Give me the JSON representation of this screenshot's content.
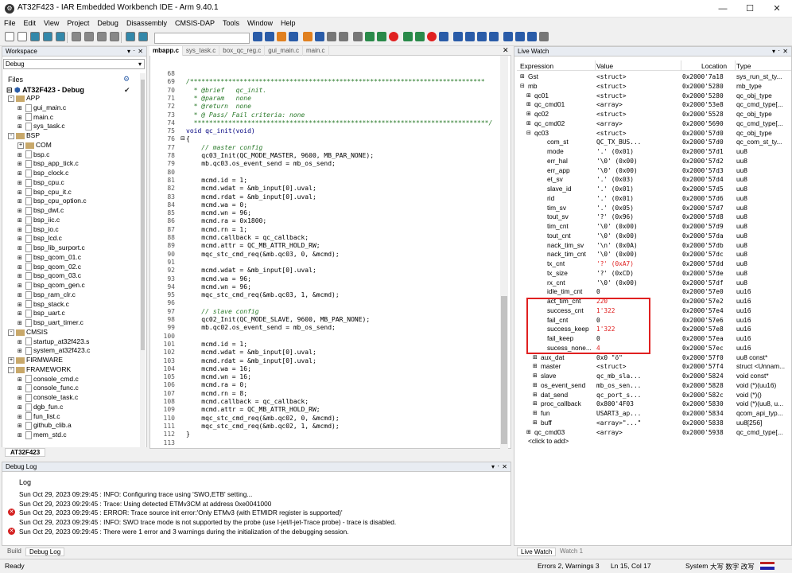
{
  "window": {
    "title": "AT32F423 - IAR Embedded Workbench IDE - Arm 9.40.1"
  },
  "menu": [
    "File",
    "Edit",
    "View",
    "Project",
    "Debug",
    "Disassembly",
    "CMSIS-DAP",
    "Tools",
    "Window",
    "Help"
  ],
  "workspace": {
    "title": "Workspace",
    "config": "Debug",
    "files_label": "Files",
    "project": "AT32F423 - Debug",
    "tab": "AT32F423",
    "tree": [
      {
        "d": 1,
        "k": "folder",
        "t": "APP",
        "ex": "-"
      },
      {
        "d": 2,
        "k": "file",
        "t": "gui_main.c"
      },
      {
        "d": 2,
        "k": "file",
        "t": "main.c"
      },
      {
        "d": 2,
        "k": "file",
        "t": "sys_task.c"
      },
      {
        "d": 1,
        "k": "folder",
        "t": "BSP",
        "ex": "-"
      },
      {
        "d": 2,
        "k": "folder",
        "t": "COM",
        "ex": "+"
      },
      {
        "d": 2,
        "k": "file",
        "t": "bsp.c"
      },
      {
        "d": 2,
        "k": "file",
        "t": "bsp_app_tick.c"
      },
      {
        "d": 2,
        "k": "file",
        "t": "bsp_clock.c"
      },
      {
        "d": 2,
        "k": "file",
        "t": "bsp_cpu.c"
      },
      {
        "d": 2,
        "k": "file",
        "t": "bsp_cpu_it.c"
      },
      {
        "d": 2,
        "k": "file",
        "t": "bsp_cpu_option.c"
      },
      {
        "d": 2,
        "k": "file",
        "t": "bsp_dwt.c"
      },
      {
        "d": 2,
        "k": "file",
        "t": "bsp_iic.c"
      },
      {
        "d": 2,
        "k": "file",
        "t": "bsp_io.c"
      },
      {
        "d": 2,
        "k": "file",
        "t": "bsp_lcd.c"
      },
      {
        "d": 2,
        "k": "file",
        "t": "bsp_lib_surport.c"
      },
      {
        "d": 2,
        "k": "file",
        "t": "bsp_qcom_01.c"
      },
      {
        "d": 2,
        "k": "file",
        "t": "bsp_qcom_02.c"
      },
      {
        "d": 2,
        "k": "file",
        "t": "bsp_qcom_03.c"
      },
      {
        "d": 2,
        "k": "file",
        "t": "bsp_qcom_gen.c"
      },
      {
        "d": 2,
        "k": "file",
        "t": "bsp_ram_clr.c"
      },
      {
        "d": 2,
        "k": "file",
        "t": "bsp_stack.c"
      },
      {
        "d": 2,
        "k": "file",
        "t": "bsp_uart.c"
      },
      {
        "d": 2,
        "k": "file",
        "t": "bsp_uart_timer.c"
      },
      {
        "d": 1,
        "k": "folder",
        "t": "CMSIS",
        "ex": "-"
      },
      {
        "d": 2,
        "k": "file",
        "t": "startup_at32f423.s"
      },
      {
        "d": 2,
        "k": "file",
        "t": "system_at32f423.c"
      },
      {
        "d": 1,
        "k": "folder",
        "t": "FIRMWARE",
        "ex": "+"
      },
      {
        "d": 1,
        "k": "folder",
        "t": "FRAMEWORK",
        "ex": "-"
      },
      {
        "d": 2,
        "k": "file",
        "t": "console_cmd.c"
      },
      {
        "d": 2,
        "k": "file",
        "t": "console_func.c"
      },
      {
        "d": 2,
        "k": "file",
        "t": "console_task.c"
      },
      {
        "d": 2,
        "k": "file",
        "t": "dgb_fun.c"
      },
      {
        "d": 2,
        "k": "file",
        "t": "fun_list.c"
      },
      {
        "d": 2,
        "k": "file",
        "t": "github_clib.a"
      },
      {
        "d": 2,
        "k": "file",
        "t": "mem_std.c"
      }
    ]
  },
  "editor": {
    "tabs": [
      "mbapp.c",
      "sys_task.c",
      "box_qc_reg.c",
      "gui_main.c",
      "main.c"
    ],
    "lines": [
      [
        "68",
        ""
      ],
      [
        "69",
        "/*****************************************************************************",
        "c"
      ],
      [
        "70",
        "  * @brief   qc_init.",
        "c"
      ],
      [
        "71",
        "  * @param   none",
        "c"
      ],
      [
        "72",
        "  * @return  none",
        "c"
      ],
      [
        "73",
        "  * @ Pass/ Fail criteria: none",
        "c"
      ],
      [
        "74",
        "  *****************************************************************************/",
        "c"
      ],
      [
        "75",
        "void qc_init(void)",
        "k"
      ],
      [
        "76",
        "{"
      ],
      [
        "77",
        "    // master config",
        "c"
      ],
      [
        "78",
        "    qc03_Init(QC_MODE_MASTER, 9600, MB_PAR_NONE);"
      ],
      [
        "79",
        "    mb.qc03.os_event_send = mb_os_send;"
      ],
      [
        "80",
        ""
      ],
      [
        "81",
        "    mcmd.id = 1;"
      ],
      [
        "82",
        "    mcmd.wdat = &mb_input[0].uval;"
      ],
      [
        "83",
        "    mcmd.rdat = &mb_input[0].uval;"
      ],
      [
        "84",
        "    mcmd.wa = 0;"
      ],
      [
        "85",
        "    mcmd.wn = 96;"
      ],
      [
        "86",
        "    mcmd.ra = 0x1800;"
      ],
      [
        "87",
        "    mcmd.rn = 1;"
      ],
      [
        "88",
        "    mcmd.callback = qc_callback;"
      ],
      [
        "89",
        "    mcmd.attr = QC_MB_ATTR_HOLD_RW;"
      ],
      [
        "90",
        "    mqc_stc_cmd_req(&mb.qc03, 0, &mcmd);"
      ],
      [
        "91",
        ""
      ],
      [
        "92",
        "    mcmd.wdat = &mb_input[0].uval;"
      ],
      [
        "93",
        "    mcmd.wa = 96;"
      ],
      [
        "94",
        "    mcmd.wn = 96;"
      ],
      [
        "95",
        "    mqc_stc_cmd_req(&mb.qc03, 1, &mcmd);"
      ],
      [
        "96",
        ""
      ],
      [
        "97",
        "    // slave config",
        "c"
      ],
      [
        "98",
        "    qc02_Init(QC_MODE_SLAVE, 9600, MB_PAR_NONE);"
      ],
      [
        "99",
        "    mb.qc02.os_event_send = mb_os_send;"
      ],
      [
        "100",
        ""
      ],
      [
        "101",
        "    mcmd.id = 1;"
      ],
      [
        "102",
        "    mcmd.wdat = &mb_input[0].uval;"
      ],
      [
        "103",
        "    mcmd.rdat = &mb_input[0].uval;"
      ],
      [
        "104",
        "    mcmd.wa = 16;"
      ],
      [
        "105",
        "    mcmd.wn = 16;"
      ],
      [
        "106",
        "    mcmd.ra = 0;"
      ],
      [
        "107",
        "    mcmd.rn = 8;"
      ],
      [
        "108",
        "    mcmd.callback = qc_callback;"
      ],
      [
        "109",
        "    mcmd.attr = QC_MB_ATTR_HOLD_RW;"
      ],
      [
        "110",
        "    mqc_stc_cmd_req(&mb.qc02, 0, &mcmd);"
      ],
      [
        "111",
        "    mqc_stc_cmd_req(&mb.qc02, 1, &mcmd);"
      ],
      [
        "112",
        "}"
      ],
      [
        "113",
        ""
      ]
    ]
  },
  "livewatch": {
    "title": "Live Watch",
    "cols": [
      "Expression",
      "Value",
      "Location",
      "Type"
    ],
    "rows": [
      {
        "d": 0,
        "ex": "+",
        "e": "Gst",
        "v": "<struct>",
        "l": "0x2000'7a18",
        "t": "sys_run_st_ty..."
      },
      {
        "d": 0,
        "ex": "-",
        "e": "mb",
        "v": "<struct>",
        "l": "0x2000'5280",
        "t": "mb_type"
      },
      {
        "d": 1,
        "ex": "+",
        "e": "qc01",
        "v": "<struct>",
        "l": "0x2000'5280",
        "t": "qc_obj_type"
      },
      {
        "d": 1,
        "ex": "+",
        "e": "qc_cmd01",
        "v": "<array>",
        "l": "0x2000'53e8",
        "t": "qc_cmd_type[..."
      },
      {
        "d": 1,
        "ex": "+",
        "e": "qc02",
        "v": "<struct>",
        "l": "0x2000'5528",
        "t": "qc_obj_type"
      },
      {
        "d": 1,
        "ex": "+",
        "e": "qc_cmd02",
        "v": "<array>",
        "l": "0x2000'5690",
        "t": "qc_cmd_type[..."
      },
      {
        "d": 1,
        "ex": "-",
        "e": "qc03",
        "v": "<struct>",
        "l": "0x2000'57d0",
        "t": "qc_obj_type"
      },
      {
        "d": 2,
        "ex": "",
        "e": "com_st",
        "v": "QC_TX_BUS...",
        "l": "0x2000'57d0",
        "t": "qc_com_st_ty..."
      },
      {
        "d": 2,
        "ex": "",
        "e": "mode",
        "v": "'.' (0x01)",
        "l": "0x2000'57d1",
        "t": "uu8"
      },
      {
        "d": 2,
        "ex": "",
        "e": "err_hal",
        "v": "'\\0' (0x00)",
        "l": "0x2000'57d2",
        "t": "uu8"
      },
      {
        "d": 2,
        "ex": "",
        "e": "err_app",
        "v": "'\\0' (0x00)",
        "l": "0x2000'57d3",
        "t": "uu8"
      },
      {
        "d": 2,
        "ex": "",
        "e": "et_sv",
        "v": "'.' (0x03)",
        "l": "0x2000'57d4",
        "t": "uu8"
      },
      {
        "d": 2,
        "ex": "",
        "e": "slave_id",
        "v": "'.' (0x01)",
        "l": "0x2000'57d5",
        "t": "uu8"
      },
      {
        "d": 2,
        "ex": "",
        "e": "rid",
        "v": "'.' (0x01)",
        "l": "0x2000'57d6",
        "t": "uu8"
      },
      {
        "d": 2,
        "ex": "",
        "e": "tim_sv",
        "v": "'.' (0x05)",
        "l": "0x2000'57d7",
        "t": "uu8"
      },
      {
        "d": 2,
        "ex": "",
        "e": "tout_sv",
        "v": "'?' (0x96)",
        "l": "0x2000'57d8",
        "t": "uu8"
      },
      {
        "d": 2,
        "ex": "",
        "e": "tim_cnt",
        "v": "'\\0' (0x00)",
        "l": "0x2000'57d9",
        "t": "uu8"
      },
      {
        "d": 2,
        "ex": "",
        "e": "tout_cnt",
        "v": "'\\0' (0x00)",
        "l": "0x2000'57da",
        "t": "uu8"
      },
      {
        "d": 2,
        "ex": "",
        "e": "nack_tim_sv",
        "v": "'\\n' (0x0A)",
        "l": "0x2000'57db",
        "t": "uu8"
      },
      {
        "d": 2,
        "ex": "",
        "e": "nack_tim_cnt",
        "v": "'\\0' (0x00)",
        "l": "0x2000'57dc",
        "t": "uu8"
      },
      {
        "d": 2,
        "ex": "",
        "e": "tx_cnt",
        "v": "'?' (0xA7)",
        "l": "0x2000'57dd",
        "t": "uu8",
        "red": true
      },
      {
        "d": 2,
        "ex": "",
        "e": "tx_size",
        "v": "'?' (0xCD)",
        "l": "0x2000'57de",
        "t": "uu8"
      },
      {
        "d": 2,
        "ex": "",
        "e": "rx_cnt",
        "v": "'\\0' (0x00)",
        "l": "0x2000'57df",
        "t": "uu8"
      },
      {
        "d": 2,
        "ex": "",
        "e": "idle_tim_cnt",
        "v": "0",
        "l": "0x2000'57e0",
        "t": "uu16"
      },
      {
        "d": 2,
        "ex": "",
        "e": "act_tim_cnt",
        "v": "220",
        "l": "0x2000'57e2",
        "t": "uu16",
        "red": true
      },
      {
        "d": 2,
        "ex": "",
        "e": "success_cnt",
        "v": "1'322",
        "l": "0x2000'57e4",
        "t": "uu16",
        "red": true
      },
      {
        "d": 2,
        "ex": "",
        "e": "fail_cnt",
        "v": "0",
        "l": "0x2000'57e6",
        "t": "uu16"
      },
      {
        "d": 2,
        "ex": "",
        "e": "success_keep",
        "v": "1'322",
        "l": "0x2000'57e8",
        "t": "uu16",
        "red": true
      },
      {
        "d": 2,
        "ex": "",
        "e": "fail_keep",
        "v": "0",
        "l": "0x2000'57ea",
        "t": "uu16"
      },
      {
        "d": 2,
        "ex": "",
        "e": "sucess_none...",
        "v": "4",
        "l": "0x2000'57ec",
        "t": "uu16",
        "red": true
      },
      {
        "d": 2,
        "ex": "+",
        "e": "aux_dat",
        "v": "0x0 \"ö\"",
        "l": "0x2000'57f0",
        "t": "uu8 const*"
      },
      {
        "d": 2,
        "ex": "+",
        "e": "master",
        "v": "<struct>",
        "l": "0x2000'57f4",
        "t": "struct <Unnam..."
      },
      {
        "d": 2,
        "ex": "+",
        "e": "slave",
        "v": "qc_mb_sla...",
        "l": "0x2000'5824",
        "t": "void const*"
      },
      {
        "d": 2,
        "ex": "+",
        "e": "os_event_send",
        "v": "mb_os_sen...",
        "l": "0x2000'5828",
        "t": "void (*)(uu16)"
      },
      {
        "d": 2,
        "ex": "+",
        "e": "dat_send",
        "v": "qc_port_s...",
        "l": "0x2000'582c",
        "t": "void (*)()"
      },
      {
        "d": 2,
        "ex": "+",
        "e": "proc_callback",
        "v": "0x800'4F03",
        "l": "0x2000'5830",
        "t": "void (*)(uu8, u..."
      },
      {
        "d": 2,
        "ex": "+",
        "e": "fun",
        "v": "USART3_ap...",
        "l": "0x2000'5834",
        "t": "qcom_api_typ..."
      },
      {
        "d": 2,
        "ex": "+",
        "e": "buff",
        "v": "<array>\"...\"",
        "l": "0x2000'5838",
        "t": "uu8[256]"
      },
      {
        "d": 1,
        "ex": "+",
        "e": "qc_cmd03",
        "v": "<array>",
        "l": "0x2000'5938",
        "t": "qc_cmd_type[..."
      },
      {
        "d": 0,
        "ex": "",
        "e": "<click to add>",
        "v": "",
        "l": "",
        "t": ""
      }
    ],
    "tabs": [
      "Live Watch",
      "Watch 1"
    ]
  },
  "debuglog": {
    "title": "Debug Log",
    "header": "Log",
    "lines": [
      {
        "err": false,
        "t": "Sun Oct 29, 2023 09:29:45 : INFO: Configuring trace using 'SWO,ETB' setting..."
      },
      {
        "err": false,
        "t": "Sun Oct 29, 2023 09:29:45 : Trace: Using detected ETMv3CM at address 0xe0041000"
      },
      {
        "err": true,
        "t": "Sun Oct 29, 2023 09:29:45 : ERROR: Trace source init error:'Only ETMv3 (with ETMIDR register is supported)'"
      },
      {
        "err": false,
        "t": "Sun Oct 29, 2023 09:29:45 : INFO: SWO trace mode is not supported by the probe (use I-jet/I-jet-Trace probe) - trace is disabled."
      },
      {
        "err": true,
        "t": "Sun Oct 29, 2023 09:29:45 : There were 1 error and 3 warnings during the initialization of the debugging session."
      }
    ],
    "tabs": [
      "Build",
      "Debug Log"
    ]
  },
  "status": {
    "ready": "Ready",
    "errors": "Errors 2, Warnings 3",
    "pos": "Ln 15, Col 17",
    "system": "System",
    "ime": "大写 数字 改写"
  },
  "colors": {
    "accent": "#e02020",
    "comment": "#2a7a2a",
    "keyword": "#00007f"
  }
}
